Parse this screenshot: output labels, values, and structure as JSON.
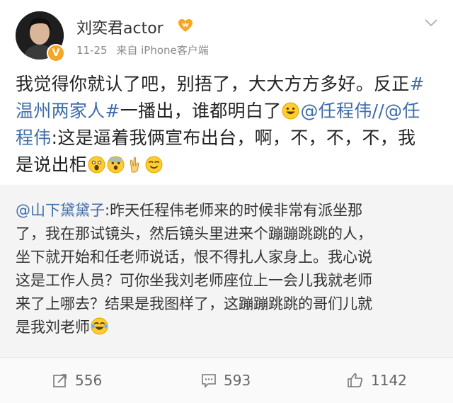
{
  "header": {
    "username": "刘奕君actor",
    "date": "11-25",
    "source": "来自 iPhone客户端"
  },
  "post": {
    "lines": [
      {
        "segments": [
          {
            "t": "我觉得你就认了吧，别捂了，大大方方多好。反正"
          },
          {
            "t": "#",
            "link": true
          }
        ]
      },
      {
        "segments": [
          {
            "t": "温州两家人#",
            "link": true
          },
          {
            "t": "一播出，谁都明白了"
          },
          {
            "emoji": "grin"
          },
          {
            "t": "@任程伟//@任",
            "link": true
          }
        ]
      },
      {
        "segments": [
          {
            "t": "程伟",
            "link": true
          },
          {
            "t": ":这是逼着我俩宣布出台，啊，不，不，不，我"
          }
        ]
      },
      {
        "segments": [
          {
            "t": "是说出柜"
          },
          {
            "emoji": "shock"
          },
          {
            "emoji": "scared"
          },
          {
            "emoji": "victory"
          },
          {
            "emoji": "smirk"
          }
        ]
      }
    ]
  },
  "quote": {
    "lines": [
      {
        "segments": [
          {
            "t": "@山下黛黛子",
            "link": true
          },
          {
            "t": ":昨天任程伟老师来的时候非常有派坐那"
          }
        ]
      },
      {
        "segments": [
          {
            "t": "了，我在那试镜头，然后镜头里进来个蹦蹦跳跳的人，"
          }
        ]
      },
      {
        "segments": [
          {
            "t": "坐下就开始和任老师说话，恨不得扎人家身上。我心说"
          }
        ]
      },
      {
        "segments": [
          {
            "t": "这是工作人员？可你坐我刘老师座位上一会儿我就老师"
          }
        ]
      },
      {
        "segments": [
          {
            "t": "来了上哪去？结果是我图样了，这蹦蹦跳跳的哥们儿就"
          }
        ]
      },
      {
        "segments": [
          {
            "t": "是我刘老师"
          },
          {
            "emoji": "laugh"
          }
        ]
      }
    ]
  },
  "actions": {
    "repost_count": "556",
    "comment_count": "593",
    "like_count": "1142"
  }
}
